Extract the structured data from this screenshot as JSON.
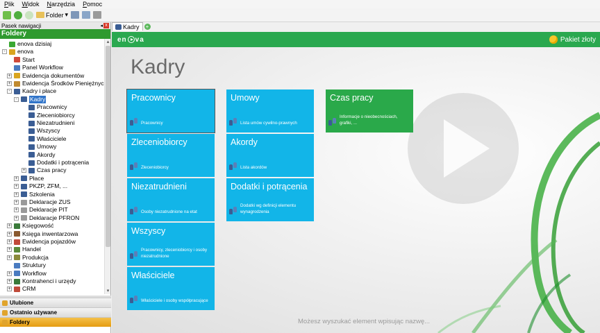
{
  "menu": [
    "Plik",
    "Widok",
    "Narzędzia",
    "Pomoc"
  ],
  "toolbar": {
    "folder_label": "Folder"
  },
  "nav_pane": {
    "header": "Pasek nawigacji",
    "folders_title": "Foldery",
    "tree": [
      {
        "label": "enova dzisiaj",
        "level": 0,
        "icon": "globe-icon",
        "color": "#3aa832",
        "exp": ""
      },
      {
        "label": "enova",
        "level": 0,
        "icon": "enova-icon",
        "color": "#d9a520",
        "exp": "-"
      },
      {
        "label": "Start",
        "level": 1,
        "icon": "start-icon",
        "color": "#d04a3a",
        "exp": ""
      },
      {
        "label": "Panel Workflow",
        "level": 1,
        "icon": "workflow-icon",
        "color": "#4a7bc0",
        "exp": ""
      },
      {
        "label": "Ewidencja dokumentów",
        "level": 1,
        "icon": "documents-icon",
        "color": "#d9a520",
        "exp": "+"
      },
      {
        "label": "Ewidencja Środków Pieniężnych",
        "level": 1,
        "icon": "money-icon",
        "color": "#c08a30",
        "exp": "+"
      },
      {
        "label": "Kadry i płace",
        "level": 1,
        "icon": "people-icon",
        "color": "#3a5d94",
        "exp": "-"
      },
      {
        "label": "Kadry",
        "level": 2,
        "icon": "people-icon",
        "color": "#3a5d94",
        "exp": "-",
        "selected": true
      },
      {
        "label": "Pracownicy",
        "level": 3,
        "icon": "people-icon",
        "color": "#3a5d94",
        "exp": ""
      },
      {
        "label": "Zleceniobiorcy",
        "level": 3,
        "icon": "people-icon",
        "color": "#3a5d94",
        "exp": ""
      },
      {
        "label": "Niezatrudnieni",
        "level": 3,
        "icon": "people-icon",
        "color": "#3a5d94",
        "exp": ""
      },
      {
        "label": "Wszyscy",
        "level": 3,
        "icon": "people-icon",
        "color": "#3a5d94",
        "exp": ""
      },
      {
        "label": "Właściciele",
        "level": 3,
        "icon": "people-icon",
        "color": "#3a5d94",
        "exp": ""
      },
      {
        "label": "Umowy",
        "level": 3,
        "icon": "people-icon",
        "color": "#3a5d94",
        "exp": ""
      },
      {
        "label": "Akordy",
        "level": 3,
        "icon": "people-icon",
        "color": "#3a5d94",
        "exp": ""
      },
      {
        "label": "Dodatki i potrącenia",
        "level": 3,
        "icon": "people-icon",
        "color": "#3a5d94",
        "exp": ""
      },
      {
        "label": "Czas pracy",
        "level": 3,
        "icon": "people-icon",
        "color": "#3a5d94",
        "exp": "+"
      },
      {
        "label": "Płace",
        "level": 2,
        "icon": "people-icon",
        "color": "#3a5d94",
        "exp": "+"
      },
      {
        "label": "PKZP, ZFM, ...",
        "level": 2,
        "icon": "people-icon",
        "color": "#3a5d94",
        "exp": "+"
      },
      {
        "label": "Szkolenia",
        "level": 2,
        "icon": "people-icon",
        "color": "#3a5d94",
        "exp": "+"
      },
      {
        "label": "Deklaracje ZUS",
        "level": 2,
        "icon": "declaration-icon",
        "color": "#9a9a9a",
        "exp": "+"
      },
      {
        "label": "Deklaracje PIT",
        "level": 2,
        "icon": "declaration-icon",
        "color": "#9a9a9a",
        "exp": "+"
      },
      {
        "label": "Deklaracje PFRON",
        "level": 2,
        "icon": "declaration-icon",
        "color": "#9a9a9a",
        "exp": "+"
      },
      {
        "label": "Księgowość",
        "level": 1,
        "icon": "accounting-icon",
        "color": "#3a7a3a",
        "exp": "+"
      },
      {
        "label": "Księga inwentarzowa",
        "level": 1,
        "icon": "inventory-icon",
        "color": "#8a5a30",
        "exp": "+"
      },
      {
        "label": "Ewidencja pojazdów",
        "level": 1,
        "icon": "vehicle-icon",
        "color": "#c04a3a",
        "exp": "+"
      },
      {
        "label": "Handel",
        "level": 1,
        "icon": "trade-icon",
        "color": "#5a8a3a",
        "exp": "+"
      },
      {
        "label": "Produkcja",
        "level": 1,
        "icon": "production-icon",
        "color": "#8a8a3a",
        "exp": "+"
      },
      {
        "label": "Struktury",
        "level": 1,
        "icon": "structure-icon",
        "color": "#4a7bc0",
        "exp": ""
      },
      {
        "label": "Workflow",
        "level": 1,
        "icon": "workflow-icon",
        "color": "#4a7bc0",
        "exp": "+"
      },
      {
        "label": "Kontrahenci i urzędy",
        "level": 1,
        "icon": "contractors-icon",
        "color": "#3a7a3a",
        "exp": "+"
      },
      {
        "label": "CRM",
        "level": 1,
        "icon": "crm-icon",
        "color": "#c04a3a",
        "exp": "+"
      }
    ],
    "bottom": [
      {
        "label": "Ulubione",
        "active": false
      },
      {
        "label": "Ostatnio używane",
        "active": false
      },
      {
        "label": "Foldery",
        "active": true
      }
    ]
  },
  "tab": {
    "label": "Kadry"
  },
  "header": {
    "logo": "enova",
    "package_label": "Pakiet złoty"
  },
  "page_title": "Kadry",
  "tiles": [
    {
      "title": "Pracownicy",
      "desc": "Pracownicy",
      "col": 0,
      "row": 0,
      "green": false,
      "selected": true
    },
    {
      "title": "Zleceniobiorcy",
      "desc": "Zleceniobiorcy",
      "col": 0,
      "row": 1,
      "green": false
    },
    {
      "title": "Niezatrudnieni",
      "desc": "Osoby niezatrudnione na etat",
      "col": 0,
      "row": 2,
      "green": false
    },
    {
      "title": "Wszyscy",
      "desc": "Pracownicy, zleceniobiorcy i osoby niezatrudnione",
      "col": 0,
      "row": 3,
      "green": false
    },
    {
      "title": "Właściciele",
      "desc": "Właściciele i osoby współpracujące",
      "col": 0,
      "row": 4,
      "green": false
    },
    {
      "title": "Umowy",
      "desc": "Lista umów cywilno-prawnych",
      "col": 1,
      "row": 0,
      "green": false
    },
    {
      "title": "Akordy",
      "desc": "Lista akordów",
      "col": 1,
      "row": 1,
      "green": false
    },
    {
      "title": "Dodatki i potrącenia",
      "desc": "Dodatki wg definicji elementu wynagrodzenia",
      "col": 1,
      "row": 2,
      "green": false
    },
    {
      "title": "Czas pracy",
      "desc": "Informacje o nieobecnościach, grafiki, ...",
      "col": 2,
      "row": 0,
      "green": true
    }
  ],
  "search_hint": "Możesz wyszukać element wpisując nazwę...",
  "colors": {
    "accent_green": "#2aa84f",
    "tile_blue": "#12b5e8",
    "tile_green": "#2aa94a",
    "selection": "#3074c9"
  }
}
